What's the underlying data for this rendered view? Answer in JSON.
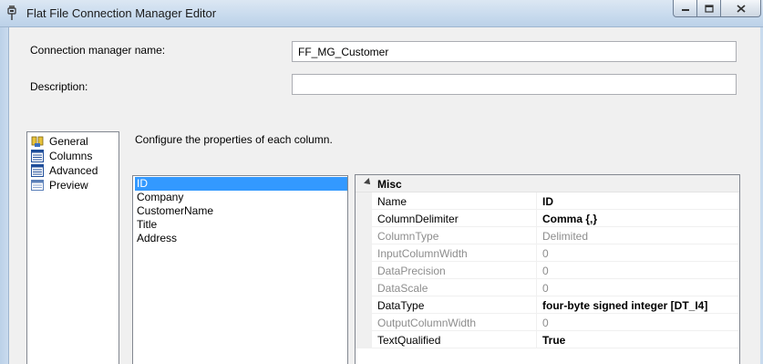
{
  "window": {
    "title": "Flat File Connection Manager Editor"
  },
  "form": {
    "connection_label": "Connection manager name:",
    "connection_value": "FF_MG_Customer",
    "description_label": "Description:",
    "description_value": ""
  },
  "nav": {
    "items": [
      {
        "label": "General",
        "icon": "general-icon"
      },
      {
        "label": "Columns",
        "icon": "columns-icon"
      },
      {
        "label": "Advanced",
        "icon": "advanced-icon"
      },
      {
        "label": "Preview",
        "icon": "preview-icon"
      }
    ]
  },
  "main": {
    "instruction": "Configure the properties of each column."
  },
  "columns": {
    "items": [
      "ID",
      "Company",
      "CustomerName",
      "Title",
      "Address"
    ],
    "selected": "ID"
  },
  "property_grid": {
    "category": "Misc",
    "rows": [
      {
        "name": "Name",
        "value": "ID",
        "readonly": false,
        "bold": true
      },
      {
        "name": "ColumnDelimiter",
        "value": "Comma {,}",
        "readonly": false,
        "bold": true
      },
      {
        "name": "ColumnType",
        "value": "Delimited",
        "readonly": true,
        "bold": false
      },
      {
        "name": "InputColumnWidth",
        "value": "0",
        "readonly": true,
        "bold": false
      },
      {
        "name": "DataPrecision",
        "value": "0",
        "readonly": true,
        "bold": false
      },
      {
        "name": "DataScale",
        "value": "0",
        "readonly": true,
        "bold": false
      },
      {
        "name": "DataType",
        "value": "four-byte signed integer [DT_I4]",
        "readonly": false,
        "bold": true
      },
      {
        "name": "OutputColumnWidth",
        "value": "0",
        "readonly": true,
        "bold": false
      },
      {
        "name": "TextQualified",
        "value": "True",
        "readonly": false,
        "bold": true
      }
    ]
  },
  "colors": {
    "selection": "#3399ff",
    "readonly_text": "#8d8d8d"
  }
}
